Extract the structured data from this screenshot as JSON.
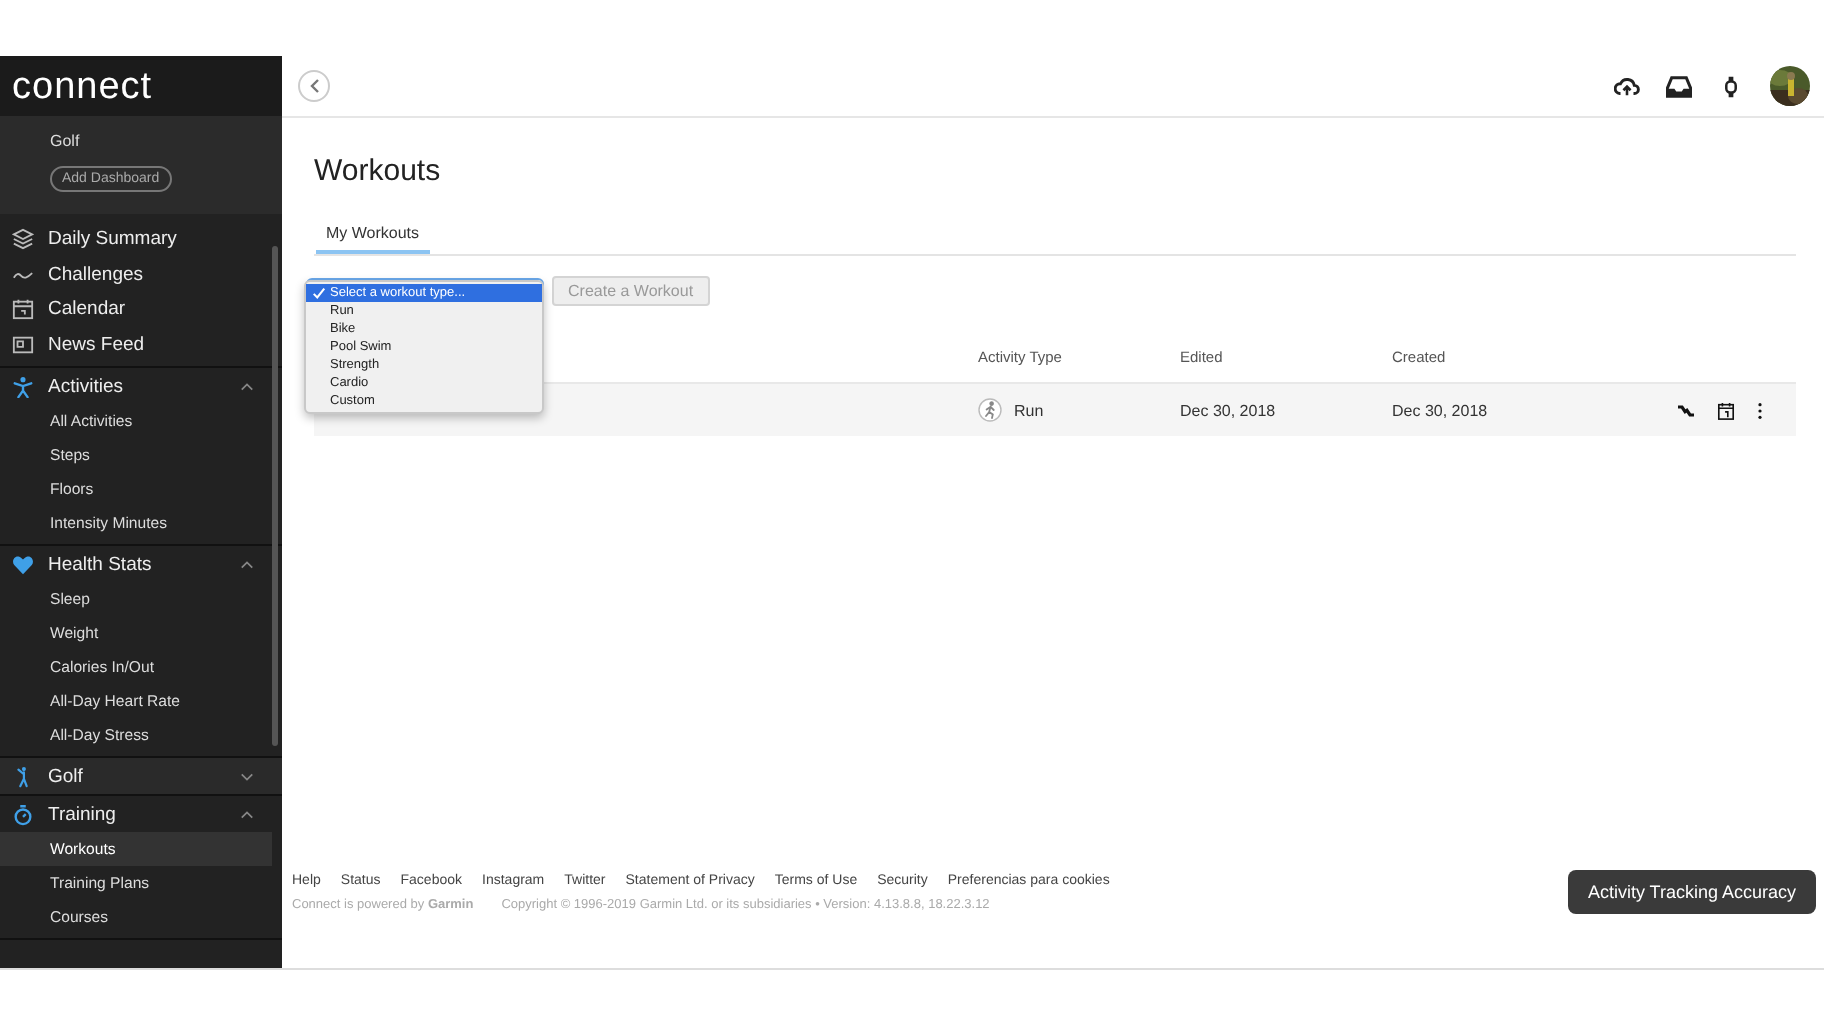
{
  "sidebar": {
    "logo": "connect",
    "dashboards": {
      "items": [
        "Golf"
      ],
      "button": "Add Dashboard"
    },
    "nav": [
      {
        "label": "Daily Summary"
      },
      {
        "label": "Challenges"
      },
      {
        "label": "Calendar"
      },
      {
        "label": "News Feed"
      }
    ],
    "sections": [
      {
        "label": "Activities",
        "expanded": true,
        "children": [
          {
            "label": "All Activities",
            "selected": false
          },
          {
            "label": "Steps",
            "selected": false
          },
          {
            "label": "Floors",
            "selected": false
          },
          {
            "label": "Intensity Minutes",
            "selected": false
          }
        ]
      },
      {
        "label": "Health Stats",
        "expanded": true,
        "children": [
          {
            "label": "Sleep",
            "selected": false
          },
          {
            "label": "Weight",
            "selected": false
          },
          {
            "label": "Calories In/Out",
            "selected": false
          },
          {
            "label": "All-Day Heart Rate",
            "selected": false
          },
          {
            "label": "All-Day Stress",
            "selected": false
          }
        ]
      },
      {
        "label": "Golf",
        "expanded": false
      },
      {
        "label": "Training",
        "expanded": true,
        "children": [
          {
            "label": "Workouts",
            "selected": true
          },
          {
            "label": "Training Plans",
            "selected": false
          },
          {
            "label": "Courses",
            "selected": false
          }
        ]
      }
    ]
  },
  "page": {
    "title": "Workouts",
    "tabs": [
      {
        "label": "My Workouts",
        "selected": true
      }
    ],
    "workout_type_dropdown": {
      "expanded": true,
      "options": [
        {
          "label": "Select a workout type...",
          "selected": true
        },
        {
          "label": "Run",
          "selected": false
        },
        {
          "label": "Bike",
          "selected": false
        },
        {
          "label": "Pool Swim",
          "selected": false
        },
        {
          "label": "Strength",
          "selected": false
        },
        {
          "label": "Cardio",
          "selected": false
        },
        {
          "label": "Custom",
          "selected": false
        }
      ]
    },
    "create_button": {
      "label": "Create a Workout",
      "disabled": true
    },
    "table": {
      "columns": [
        "Activity Type",
        "Edited",
        "Created"
      ],
      "rows": [
        {
          "activity_type": "Run",
          "edited": "Dec 30, 2018",
          "created": "Dec 30, 2018"
        }
      ]
    }
  },
  "footer": {
    "links": [
      "Help",
      "Status",
      "Facebook",
      "Instagram",
      "Twitter",
      "Statement of Privacy",
      "Terms of Use",
      "Security",
      "Preferencias para cookies"
    ],
    "powered_by": "Connect is powered by **Garmin**",
    "copyright": "Copyright © 1996-2019 Garmin Ltd. or its subsidiaries • Version: 4.13.8.8, 18.22.3.12"
  },
  "accuracy_button": "Activity Tracking Accuracy"
}
